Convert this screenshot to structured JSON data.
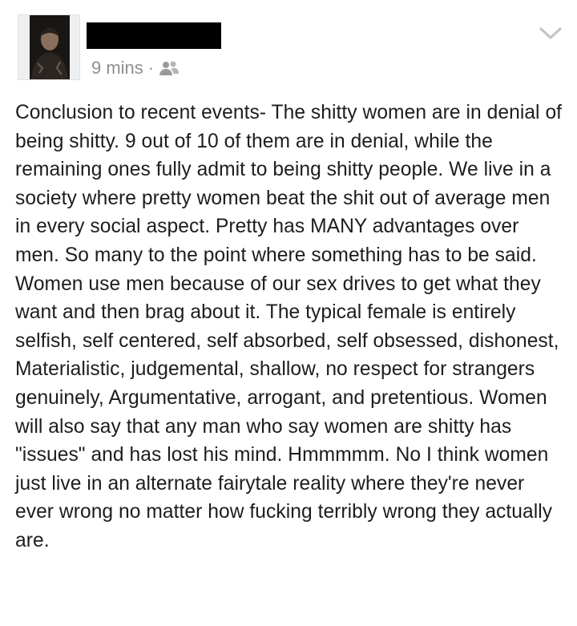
{
  "post": {
    "timestamp": "9 mins",
    "separator": "·",
    "audience_icon": "friends-icon",
    "menu_icon": "chevron-down-icon",
    "text": "Conclusion to recent events- The shitty women are in denial of being shitty. 9 out of 10 of them are in denial, while the remaining ones fully admit to being shitty people. We live in a society where pretty women beat the shit out of average men in every social aspect. Pretty has MANY advantages over men. So many to the point where something has to be said. Women use men because of our sex drives to get what they want and then brag about it. The typical female is entirely selfish, self centered, self absorbed, self obsessed, dishonest, Materialistic, judgemental, shallow, no respect for strangers genuinely, Argumentative, arrogant, and pretentious. Women will also say that any man who say women are shitty has \"issues\" and has lost his mind. Hmmmmm. No I think women just live in an alternate fairytale reality where they're never ever wrong no matter how fucking terribly wrong they actually are."
  },
  "colors": {
    "text": "#1d1d1d",
    "meta": "#8f8f8f",
    "redaction": "#000000",
    "background": "#ffffff"
  }
}
